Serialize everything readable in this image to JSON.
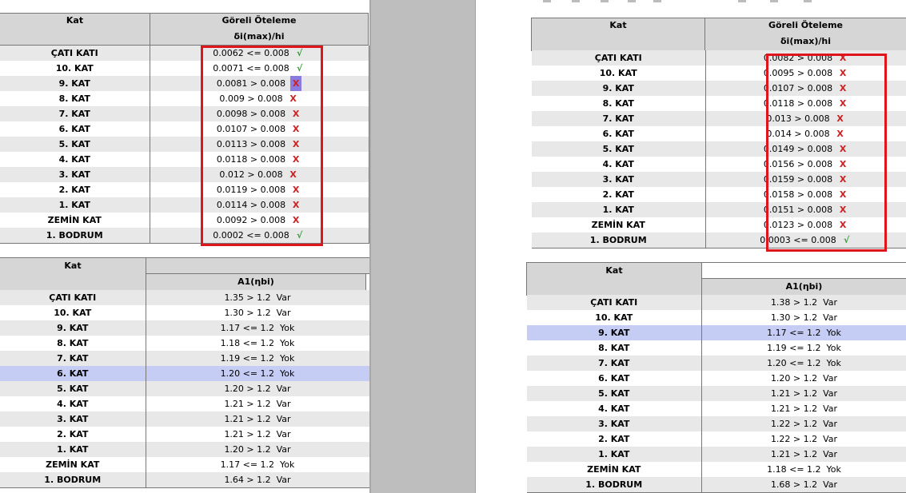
{
  "left": {
    "drift": {
      "kat_header": "Kat",
      "title": "Göreli Öteleme",
      "subtitle": "δi(max)/hi",
      "rows": [
        {
          "kat": "ÇATI KATI",
          "val": "0.0062 <= 0.008",
          "mark": "√",
          "status": "ok"
        },
        {
          "kat": "10. KAT",
          "val": "0.0071 <= 0.008",
          "mark": "√",
          "status": "ok"
        },
        {
          "kat": "9. KAT",
          "val": "0.0081 > 0.008",
          "mark": "X",
          "status": "sel"
        },
        {
          "kat": "8. KAT",
          "val": "0.009 > 0.008",
          "mark": "X",
          "status": "x"
        },
        {
          "kat": "7. KAT",
          "val": "0.0098 > 0.008",
          "mark": "X",
          "status": "x"
        },
        {
          "kat": "6. KAT",
          "val": "0.0107 > 0.008",
          "mark": "X",
          "status": "x"
        },
        {
          "kat": "5. KAT",
          "val": "0.0113 > 0.008",
          "mark": "X",
          "status": "x"
        },
        {
          "kat": "4. KAT",
          "val": "0.0118 > 0.008",
          "mark": "X",
          "status": "x"
        },
        {
          "kat": "3. KAT",
          "val": "0.012 > 0.008",
          "mark": "X",
          "status": "x"
        },
        {
          "kat": "2. KAT",
          "val": "0.0119 > 0.008",
          "mark": "X",
          "status": "x"
        },
        {
          "kat": "1. KAT",
          "val": "0.0114 > 0.008",
          "mark": "X",
          "status": "x"
        },
        {
          "kat": "ZEMİN KAT",
          "val": "0.0092 > 0.008",
          "mark": "X",
          "status": "x"
        },
        {
          "kat": "1. BODRUM",
          "val": "0.0002 <= 0.008",
          "mark": "√",
          "status": "ok"
        }
      ]
    },
    "a1": {
      "kat_header": "Kat",
      "title": "A1(ηbi)",
      "rows": [
        {
          "kat": "ÇATI KATI",
          "val": "1.35 > 1.2  Var"
        },
        {
          "kat": "10. KAT",
          "val": "1.30 > 1.2  Var"
        },
        {
          "kat": "9. KAT",
          "val": "1.17 <= 1.2  Yok"
        },
        {
          "kat": "8. KAT",
          "val": "1.18 <= 1.2  Yok"
        },
        {
          "kat": "7. KAT",
          "val": "1.19 <= 1.2  Yok"
        },
        {
          "kat": "6. KAT",
          "val": "1.20 <= 1.2  Yok"
        },
        {
          "kat": "5. KAT",
          "val": "1.20 > 1.2  Var"
        },
        {
          "kat": "4. KAT",
          "val": "1.21 > 1.2  Var"
        },
        {
          "kat": "3. KAT",
          "val": "1.21 > 1.2  Var"
        },
        {
          "kat": "2. KAT",
          "val": "1.21 > 1.2  Var"
        },
        {
          "kat": "1. KAT",
          "val": "1.20 > 1.2  Var"
        },
        {
          "kat": "ZEMİN KAT",
          "val": "1.17 <= 1.2  Yok"
        },
        {
          "kat": "1. BODRUM",
          "val": "1.64 > 1.2  Var"
        }
      ],
      "selected_row": 5
    }
  },
  "right": {
    "drift": {
      "kat_header": "Kat",
      "title": "Göreli Öteleme",
      "subtitle": "δi(max)/hi",
      "rows": [
        {
          "kat": "ÇATI KATI",
          "val": "0.0082 > 0.008",
          "mark": "X",
          "status": "x"
        },
        {
          "kat": "10. KAT",
          "val": "0.0095 > 0.008",
          "mark": "X",
          "status": "x"
        },
        {
          "kat": "9. KAT",
          "val": "0.0107 > 0.008",
          "mark": "X",
          "status": "x"
        },
        {
          "kat": "8. KAT",
          "val": "0.0118 > 0.008",
          "mark": "X",
          "status": "x"
        },
        {
          "kat": "7. KAT",
          "val": "0.013 > 0.008",
          "mark": "X",
          "status": "x"
        },
        {
          "kat": "6. KAT",
          "val": "0.014 > 0.008",
          "mark": "X",
          "status": "x"
        },
        {
          "kat": "5. KAT",
          "val": "0.0149 > 0.008",
          "mark": "X",
          "status": "x"
        },
        {
          "kat": "4. KAT",
          "val": "0.0156 > 0.008",
          "mark": "X",
          "status": "x"
        },
        {
          "kat": "3. KAT",
          "val": "0.0159 > 0.008",
          "mark": "X",
          "status": "x"
        },
        {
          "kat": "2. KAT",
          "val": "0.0158 > 0.008",
          "mark": "X",
          "status": "x"
        },
        {
          "kat": "1. KAT",
          "val": "0.0151 > 0.008",
          "mark": "X",
          "status": "x"
        },
        {
          "kat": "ZEMİN KAT",
          "val": "0.0123 > 0.008",
          "mark": "X",
          "status": "x"
        },
        {
          "kat": "1. BODRUM",
          "val": "0.0003 <= 0.008",
          "mark": "√",
          "status": "ok"
        }
      ]
    },
    "a1": {
      "kat_header": "Kat",
      "title": "A1(ηbi)",
      "rows": [
        {
          "kat": "ÇATI KATI",
          "val": "1.38 > 1.2  Var"
        },
        {
          "kat": "10. KAT",
          "val": "1.30 > 1.2  Var"
        },
        {
          "kat": "9. KAT",
          "val": "1.17 <= 1.2  Yok"
        },
        {
          "kat": "8. KAT",
          "val": "1.19 <= 1.2  Yok"
        },
        {
          "kat": "7. KAT",
          "val": "1.20 <= 1.2  Yok"
        },
        {
          "kat": "6. KAT",
          "val": "1.20 > 1.2  Var"
        },
        {
          "kat": "5. KAT",
          "val": "1.21 > 1.2  Var"
        },
        {
          "kat": "4. KAT",
          "val": "1.21 > 1.2  Var"
        },
        {
          "kat": "3. KAT",
          "val": "1.22 > 1.2  Var"
        },
        {
          "kat": "2. KAT",
          "val": "1.22 > 1.2  Var"
        },
        {
          "kat": "1. KAT",
          "val": "1.21 > 1.2  Var"
        },
        {
          "kat": "ZEMİN KAT",
          "val": "1.18 <= 1.2  Yok"
        },
        {
          "kat": "1. BODRUM",
          "val": "1.68 > 1.2  Var"
        }
      ],
      "selected_row": 2
    }
  },
  "colors": {
    "highlight": "#e0151b",
    "selected_row": "#c6cdf5",
    "fail": "#d21e1e",
    "pass": "#2a9e2a"
  }
}
